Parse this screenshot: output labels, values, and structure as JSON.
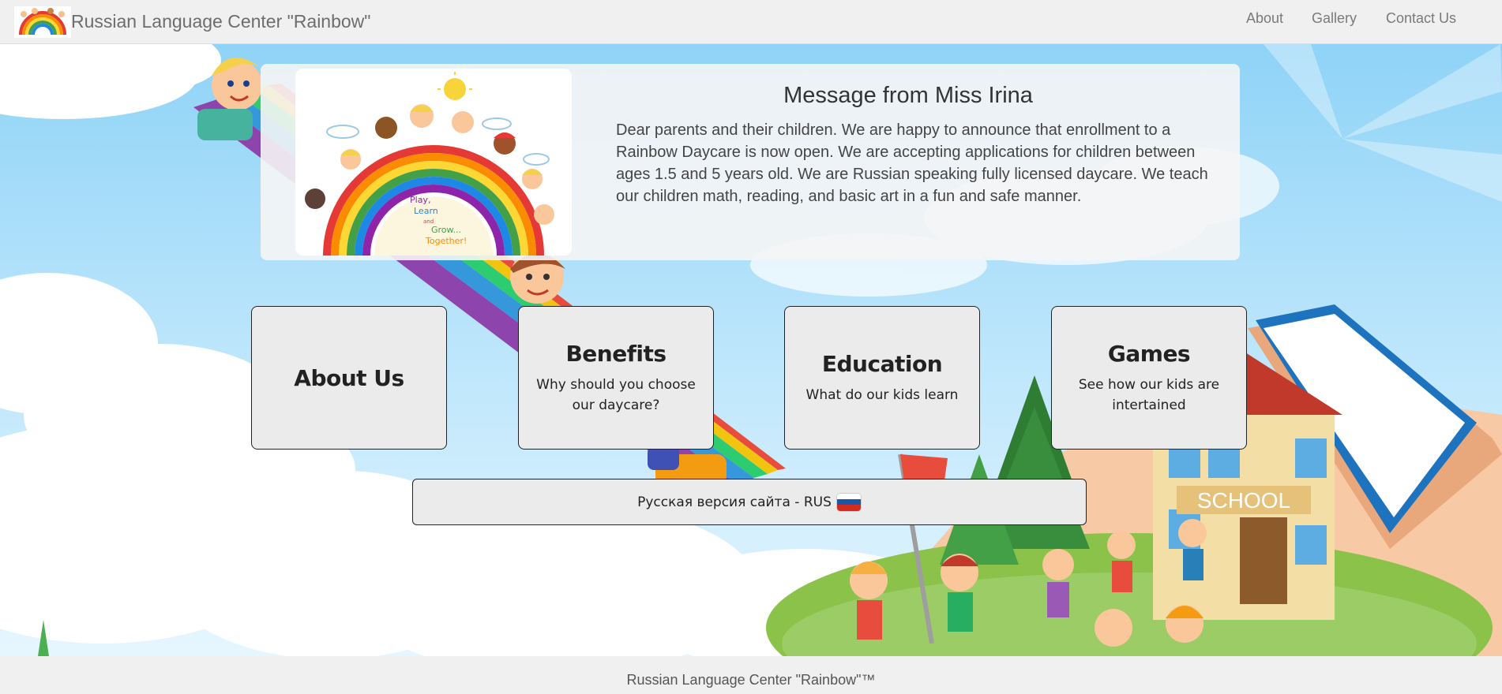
{
  "navbar": {
    "brand": "Russian Language Center \"Rainbow\"",
    "links": [
      "About",
      "Gallery",
      "Contact Us"
    ]
  },
  "message": {
    "title": "Message from Miss Irina",
    "body": "Dear parents and their children. We are happy to announce that enrollment to a Rainbow Daycare is now open. We are accepting applications for children between ages 1.5 and 5 years old. We are Russian speaking fully licensed daycare. We teach our children math, reading, and basic art in a fun and safe manner.",
    "image_text": [
      "Play,",
      "Learn",
      "and",
      "Grow...",
      "Together!"
    ]
  },
  "tiles": [
    {
      "title": "About Us",
      "subtitle": ""
    },
    {
      "title": "Benefits",
      "subtitle": "Why should you choose our daycare?"
    },
    {
      "title": "Education",
      "subtitle": "What do our kids learn"
    },
    {
      "title": "Games",
      "subtitle": "See how our kids are intertained"
    }
  ],
  "russian_button": "Русская версия сайта - RUS",
  "footer": "Russian Language Center \"Rainbow\"™",
  "colors": {
    "navbar_bg": "#f0f0f0",
    "tile_bg": "#ebebeb",
    "sky": "#8fd3f7"
  }
}
